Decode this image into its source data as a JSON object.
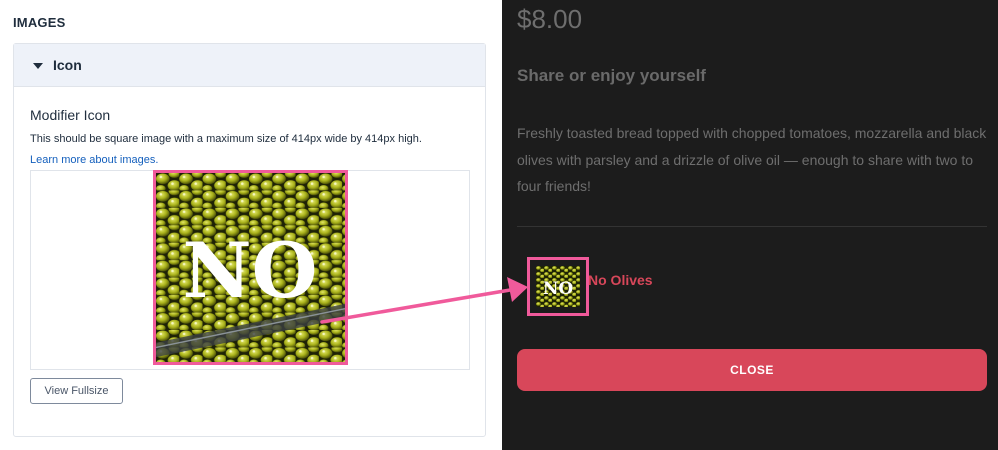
{
  "left": {
    "section_heading": "IMAGES",
    "card": {
      "header_label": "Icon",
      "field_label": "Modifier Icon",
      "help_text": "This should be square image with a maximum size of 414px wide by 414px high.",
      "help_link": "Learn more about images.",
      "image_overlay_text": "NO",
      "view_button": "View Fullsize"
    }
  },
  "right": {
    "price": "$8.00",
    "subtitle": "Share or enjoy yourself",
    "description": "Freshly toasted bread topped with chopped tomatoes, mozzarella and black olives with parsley and a drizzle of olive oil — enough to share with two to four friends!",
    "modifier_icon_text": "NO",
    "modifier_name": "No Olives",
    "close_button": "CLOSE"
  },
  "colors": {
    "highlight": "#f05a9b",
    "accent_red": "#d8475a",
    "dark_bg": "#1c1c1c",
    "link_blue": "#1560bd"
  },
  "icons": [
    "caret-down-icon",
    "olive-image",
    "annotation-arrow"
  ]
}
